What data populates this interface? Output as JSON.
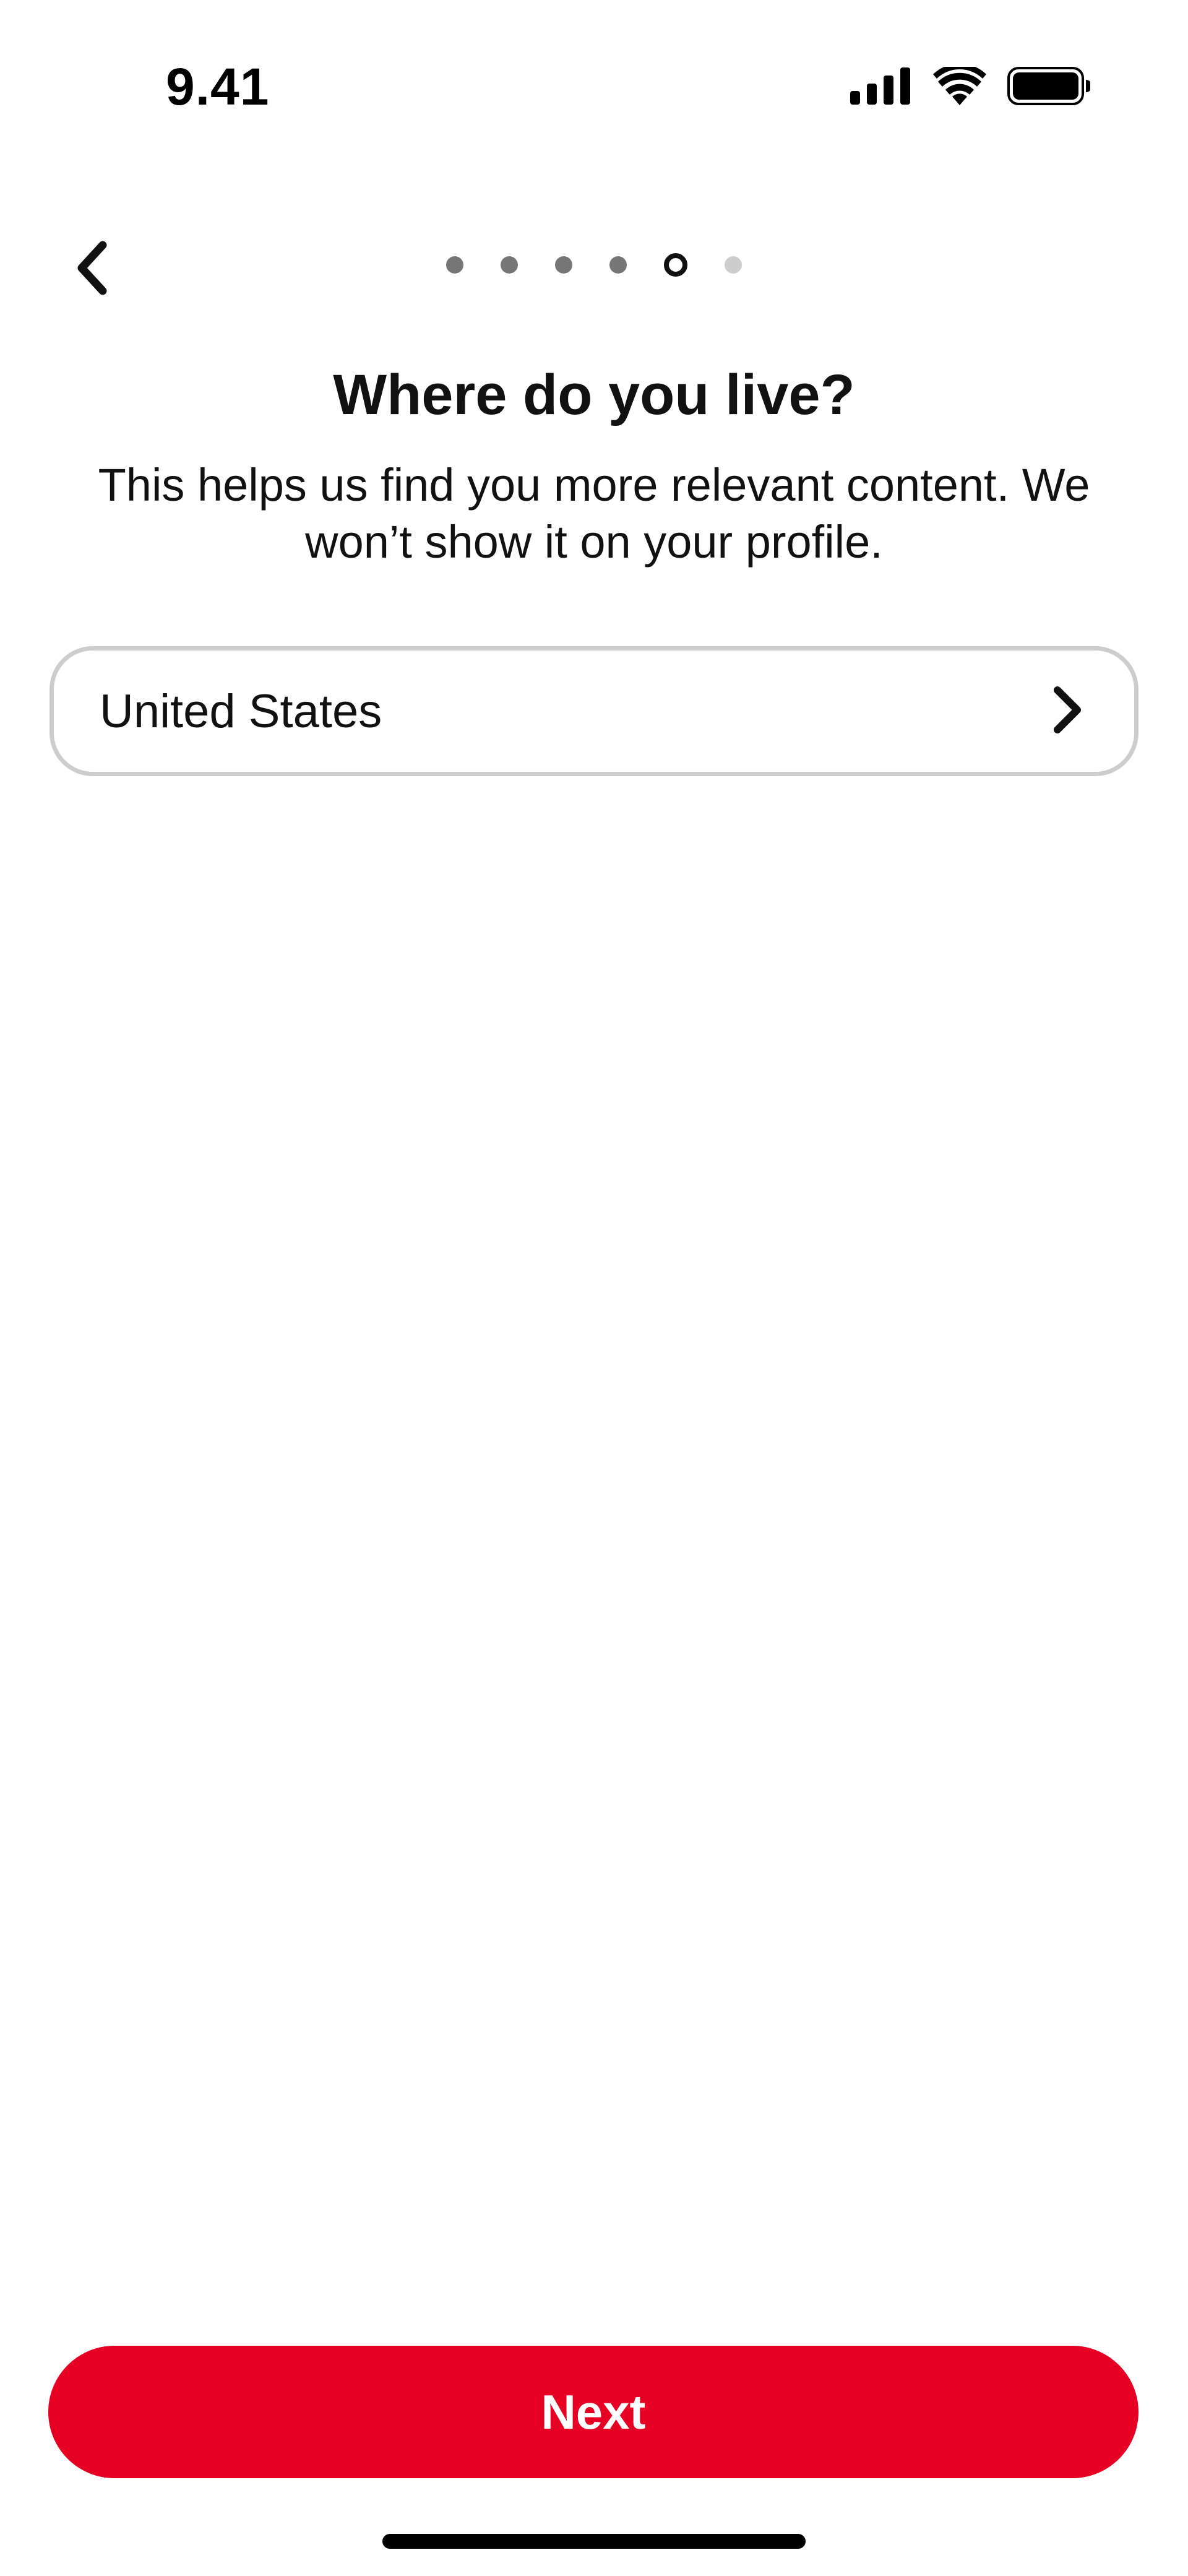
{
  "status_bar": {
    "time": "9.41",
    "icons": [
      "cellular-signal-icon",
      "wifi-icon",
      "battery-icon"
    ]
  },
  "nav": {
    "back_icon": "chevron-left-icon"
  },
  "progress": {
    "total_steps": 6,
    "current_step": 5,
    "colors": {
      "done": "#767676",
      "current": "#111111",
      "todo": "#cdcdcd"
    }
  },
  "page": {
    "title": "Where do you live?",
    "subtitle": "This helps us find you more relevant content. We won’t show it on your profile."
  },
  "country_select": {
    "value": "United States",
    "icon": "chevron-right-icon"
  },
  "footer": {
    "next_label": "Next",
    "accent_color": "#e60023"
  }
}
